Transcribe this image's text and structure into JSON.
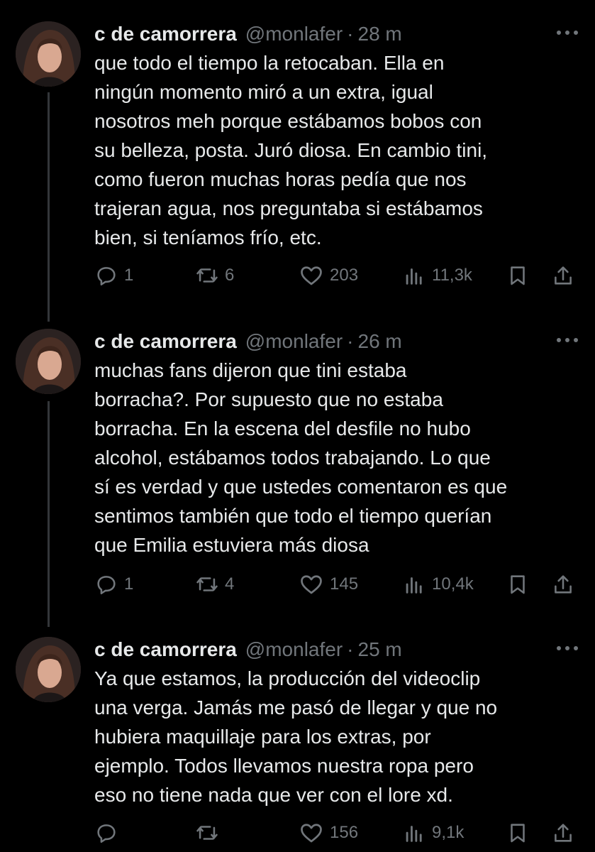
{
  "colors": {
    "background": "#000000",
    "text": "#e7e9ea",
    "muted": "#71767b",
    "thread_line": "#333639"
  },
  "tweets": [
    {
      "name": "c de camorrera",
      "handle": "@monlafer",
      "dot": "·",
      "time": "28 m",
      "text": "que todo el tiempo la retocaban. Ella en\nningún momento miró a un extra, igual\nnosotros meh porque estábamos bobos con\nsu belleza, posta. Juró diosa. En cambio tini,\ncomo fueron muchas horas pedía que nos\ntrajeran agua, nos preguntaba si estábamos\nbien, si teníamos frío, etc.",
      "replies": "1",
      "reposts": "6",
      "likes": "203",
      "views": "11,3k"
    },
    {
      "name": "c de camorrera",
      "handle": "@monlafer",
      "dot": "·",
      "time": "26 m",
      "text": "muchas fans dijeron que tini estaba\nborracha?. Por supuesto que no estaba\nborracha. En la escena del desfile no hubo\nalcohol, estábamos todos trabajando. Lo que\nsí es verdad y que ustedes comentaron es que\nsentimos también que todo el tiempo querían\nque Emilia estuviera más diosa",
      "replies": "1",
      "reposts": "4",
      "likes": "145",
      "views": "10,4k"
    },
    {
      "name": "c de camorrera",
      "handle": "@monlafer",
      "dot": "·",
      "time": "25 m",
      "text": "Ya que estamos, la producción del videoclip\nuna verga. Jamás me pasó de llegar y que no\nhubiera maquillaje para los extras, por\nejemplo. Todos llevamos nuestra ropa pero\neso no tiene nada que ver con el lore xd.",
      "replies": "",
      "reposts": "",
      "likes": "156",
      "views": "9,1k"
    }
  ],
  "icons": {
    "reply": "reply-icon",
    "repost": "repost-icon",
    "like": "heart-icon",
    "views": "views-icon",
    "bookmark": "bookmark-icon",
    "share": "share-icon",
    "more": "more-icon"
  }
}
